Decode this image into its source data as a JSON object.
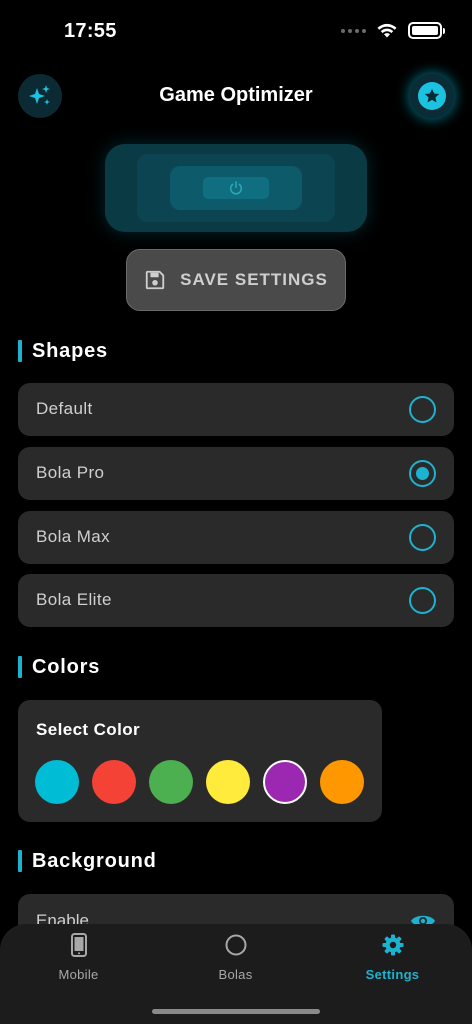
{
  "status_bar": {
    "time": "17:55"
  },
  "header": {
    "title": "Game Optimizer",
    "left_icon": "sparkles-icon",
    "right_icon": "star-icon",
    "accent_color": "#1cb3d1"
  },
  "power": {
    "icon": "power-icon"
  },
  "save": {
    "label": "SAVE SETTINGS",
    "icon": "floppy-disk-icon"
  },
  "shapes": {
    "title": "Shapes",
    "options": [
      {
        "label": "Default",
        "selected": false
      },
      {
        "label": "Bola Pro",
        "selected": true
      },
      {
        "label": "Bola Max",
        "selected": false
      },
      {
        "label": "Bola Elite",
        "selected": false
      }
    ]
  },
  "colors": {
    "title": "Colors",
    "card_title": "Select Color",
    "swatches": [
      "#00bcd4",
      "#f44336",
      "#4caf50",
      "#ffeb3b",
      "#9c27b0",
      "#ff9800"
    ],
    "selected_index": 4
  },
  "background": {
    "title": "Background",
    "enable_label": "Enable",
    "icon": "eye-icon"
  },
  "tabs": [
    {
      "label": "Mobile",
      "icon": "phone-icon",
      "active": false
    },
    {
      "label": "Bolas",
      "icon": "circle-icon",
      "active": false
    },
    {
      "label": "Settings",
      "icon": "gear-icon",
      "active": true
    }
  ]
}
